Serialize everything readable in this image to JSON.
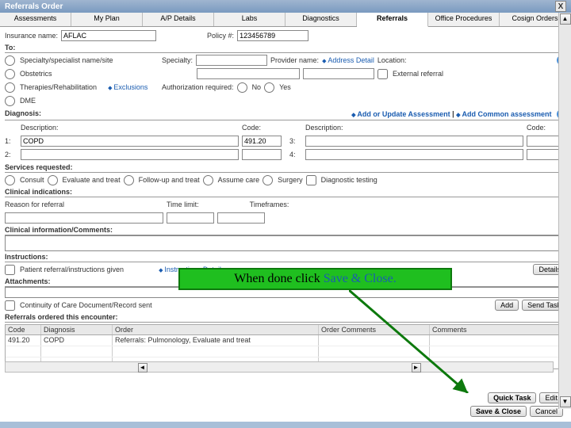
{
  "window": {
    "title": "Referrals Order",
    "close": "X"
  },
  "tabs": {
    "items": [
      "Assessments",
      "My Plan",
      "A/P Details",
      "Labs",
      "Diagnostics",
      "Referrals",
      "Office Procedures",
      "Cosign Orders"
    ],
    "activeIndex": 5
  },
  "insurance": {
    "name_label": "Insurance name:",
    "name_value": "AFLAC",
    "policy_label": "Policy #:",
    "policy_value": "123456789"
  },
  "to": {
    "label": "To:",
    "options": [
      "Specialty/specialist name/site",
      "Obstetrics",
      "Therapies/Rehabilitation",
      "DME"
    ],
    "exclusions_link": "Exclusions",
    "specialty_label": "Specialty:",
    "provider_label": "Provider name:",
    "address_link": "Address Detail",
    "location_label": "Location:",
    "external_label": "External referral",
    "auth_label": "Authorization required:",
    "auth_no": "No",
    "auth_yes": "Yes"
  },
  "diagnosis": {
    "header": "Diagnosis:",
    "add_update_link": "Add or Update Assessment",
    "add_common_link": "Add Common assessment",
    "desc_label": "Description:",
    "code_label": "Code:",
    "rows_left": [
      {
        "n": "1:",
        "desc": "COPD",
        "code": "491.20"
      },
      {
        "n": "2:",
        "desc": "",
        "code": ""
      }
    ],
    "rows_right": [
      {
        "n": "3:",
        "desc": "",
        "code": ""
      },
      {
        "n": "4:",
        "desc": "",
        "code": ""
      }
    ]
  },
  "services": {
    "header": "Services requested:",
    "options": [
      "Consult",
      "Evaluate and treat",
      "Follow-up and treat",
      "Assume care",
      "Surgery"
    ],
    "diag_testing": "Diagnostic testing"
  },
  "clinical": {
    "header": "Clinical indications:",
    "reason_label": "Reason for referral",
    "timelimit_label": "Time limit:",
    "timeframes_label": "Timeframes:"
  },
  "clinical_info_header": "Clinical information/Comments:",
  "instructions": {
    "header": "Instructions:",
    "patient_checkbox": "Patient referral/instructions given",
    "detail_link": "Instructions Detail",
    "details_btn": "Details"
  },
  "attachments": {
    "header": "Attachments:",
    "coc_checkbox": "Continuity of Care Document/Record sent",
    "add_btn": "Add",
    "sendtask_btn": "Send Task"
  },
  "referrals_ordered": {
    "header": "Referrals ordered this encounter:",
    "cols": [
      "Code",
      "Diagnosis",
      "Order",
      "Order Comments",
      "Comments"
    ],
    "row": {
      "code": "491.20",
      "diag": "COPD",
      "order": "Referrals: Pulmonology, Evaluate and treat",
      "oc": "",
      "c": ""
    }
  },
  "footer": {
    "quicktask": "Quick Task",
    "edit": "Edit",
    "saveclose": "Save & Close",
    "cancel": "Cancel"
  },
  "callout": {
    "text1": "When done click ",
    "text2": "Save & Close."
  }
}
